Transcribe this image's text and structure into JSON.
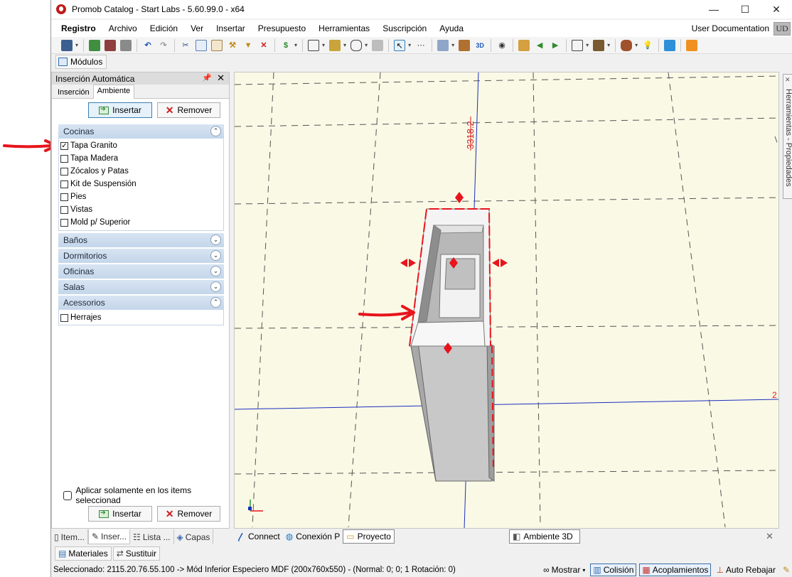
{
  "window": {
    "title": "Promob Catalog - Start Labs - 5.60.99.0 - x64",
    "controls": [
      "—",
      "☐",
      "✕"
    ]
  },
  "menubar": {
    "items": [
      "Registro",
      "Archivo",
      "Edición",
      "Ver",
      "Insertar",
      "Presupuesto",
      "Herramientas",
      "Suscripción",
      "Ayuda"
    ],
    "user_documentation": "User Documentation",
    "user_badge": "UD"
  },
  "modules_label": "Módulos",
  "left_panel": {
    "title": "Inserción Automática",
    "tabs": [
      "Inserción",
      "Ambiente"
    ],
    "active_tab": "Ambiente",
    "insert_label": "Insertar",
    "remove_label": "Remover",
    "categories": {
      "cocinas": {
        "label": "Cocinas",
        "items": [
          {
            "label": "Tapa Granito",
            "checked": true
          },
          {
            "label": "Tapa Madera",
            "checked": false
          },
          {
            "label": "Zócalos y Patas",
            "checked": false
          },
          {
            "label": "Kit de Suspensión",
            "checked": false
          },
          {
            "label": "Pies",
            "checked": false
          },
          {
            "label": "Vistas",
            "checked": false
          },
          {
            "label": "Mold p/ Superior",
            "checked": false
          }
        ]
      },
      "banos": {
        "label": "Baños"
      },
      "dormitorios": {
        "label": "Dormitorios"
      },
      "oficinas": {
        "label": "Oficinas"
      },
      "salas": {
        "label": "Salas"
      },
      "acessorios": {
        "label": "Acessorios",
        "items": [
          {
            "label": "Herrajes",
            "checked": false
          }
        ]
      }
    },
    "apply_selected_label": "Aplicar solamente en los items seleccionad",
    "bottom_tabs": [
      "Item...",
      "Inser...",
      "Lista ...",
      "Capas"
    ]
  },
  "viewport": {
    "dimension_label": "3318.2",
    "side_panel_label": "Herramientas - Propiedades"
  },
  "view_tabs": {
    "connect": "Connect",
    "conexion": "Conexión P",
    "proyecto": "Proyecto",
    "ambiente3d": "Ambiente 3D"
  },
  "extra_buttons": {
    "materiales": "Materiales",
    "sustituir": "Sustituir"
  },
  "statusbar": {
    "selected_text": "Seleccionado: 2115.20.76.55.100 -> Mód Inferior Especiero MDF (200x760x550) - (Normal: 0; 0; 1 Rotación: 0)",
    "mostrar": "Mostrar",
    "colision": "Colisión",
    "acoplamientos": "Acoplamientos",
    "auto_rebajar": "Auto Rebajar"
  },
  "colors": {
    "accent_red": "#e8141c",
    "viewport_bg": "#faf9e6",
    "category_header": "#c9d9eb"
  }
}
